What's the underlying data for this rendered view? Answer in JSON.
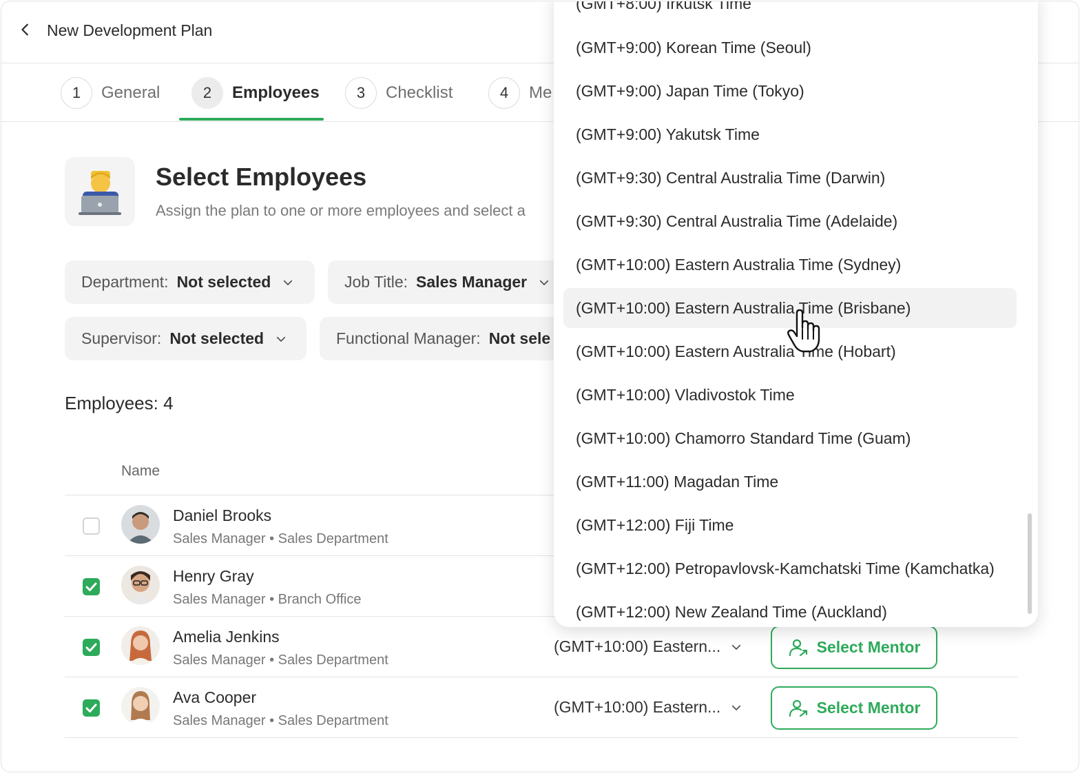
{
  "header": {
    "back_icon": "chevron-left-icon",
    "title": "New Development Plan"
  },
  "tabs": [
    {
      "num": "1",
      "label": "General"
    },
    {
      "num": "2",
      "label": "Employees",
      "active": true
    },
    {
      "num": "3",
      "label": "Checklist"
    },
    {
      "num": "4",
      "label": "Me"
    }
  ],
  "section": {
    "icon": "technologist-emoji-icon",
    "title": "Select Employees",
    "subtitle": "Assign the plan to one or more employees and select a"
  },
  "filters": {
    "department": {
      "label": "Department:",
      "value": "Not selected"
    },
    "job_title": {
      "label": "Job Title:",
      "value": "Sales Manager"
    },
    "supervisor": {
      "label": "Supervisor:",
      "value": "Not selected"
    },
    "functional_manager": {
      "label": "Functional Manager:",
      "value": "Not sele"
    }
  },
  "employees_count": "Employees: 4",
  "table": {
    "col_name": "Name",
    "rows": [
      {
        "name": "Daniel Brooks",
        "role": "Sales Manager",
        "dept": "Sales Department",
        "checked": false
      },
      {
        "name": "Henry Gray",
        "role": "Sales Manager",
        "dept": "Branch Office",
        "checked": true
      },
      {
        "name": "Amelia Jenkins",
        "role": "Sales Manager",
        "dept": "Sales Department",
        "checked": true,
        "timezone": "(GMT+10:00) Eastern...",
        "mentor": "Select Mentor"
      },
      {
        "name": "Ava Cooper",
        "role": "Sales Manager",
        "dept": "Sales Department",
        "checked": true,
        "timezone": "(GMT+10:00) Eastern...",
        "mentor": "Select Mentor"
      }
    ],
    "separator": "•"
  },
  "timezone_dropdown": {
    "items": [
      "(GMT+8:00) Irkutsk Time",
      "(GMT+9:00) Korean Time (Seoul)",
      "(GMT+9:00) Japan Time (Tokyo)",
      "(GMT+9:00) Yakutsk Time",
      "(GMT+9:30) Central Australia Time (Darwin)",
      "(GMT+9:30) Central Australia Time (Adelaide)",
      "(GMT+10:00) Eastern Australia Time (Sydney)",
      "(GMT+10:00) Eastern Australia Time (Brisbane)",
      "(GMT+10:00) Eastern Australia Time (Hobart)",
      "(GMT+10:00) Vladivostok Time",
      "(GMT+10:00) Chamorro Standard Time (Guam)",
      "(GMT+11:00) Magadan Time",
      "(GMT+12:00) Fiji Time",
      "(GMT+12:00) Petropavlovsk-Kamchatski Time (Kamchatka)",
      "(GMT+12:00) New Zealand Time (Auckland)"
    ],
    "hovered": "(GMT+10:00) Eastern Australia Time (Brisbane)"
  },
  "colors": {
    "accent": "#2daa5a",
    "text": "#2b2b2b",
    "muted": "#777777"
  }
}
